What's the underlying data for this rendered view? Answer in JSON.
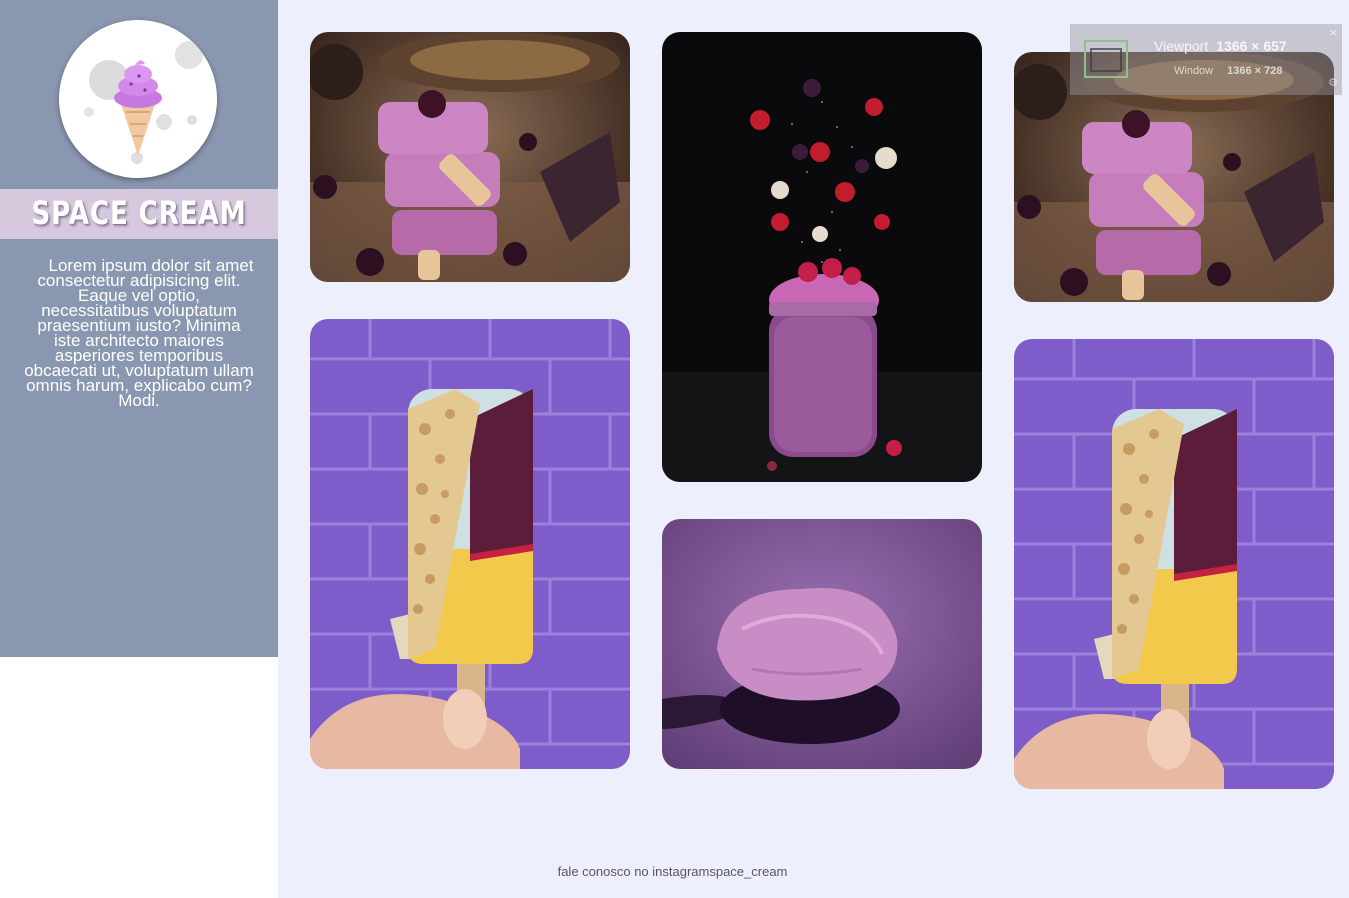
{
  "sidebar": {
    "brand_title": "SPACE CREAM",
    "description": "Lorem ipsum dolor sit amet consectetur adipisicing elit. Eaque vel optio, necessitatibus voluptatum praesentium iusto? Minima iste architecto maiores asperiores temporibus obcaecati ut, voluptatum ullam omnis harum, explicabo cum? Modi.",
    "logo_icon": "ice-cream-cone-icon"
  },
  "gallery": {
    "images": [
      {
        "subject": "stacked purple berry popsicles"
      },
      {
        "subject": "berry smoothie jar with flying fruit"
      },
      {
        "subject": "stacked purple berry popsicles"
      },
      {
        "subject": "nut-coated popsicle on purple brick wall"
      },
      {
        "subject": "spoon of pink ice cream"
      },
      {
        "subject": "nut-coated popsicle on purple brick wall"
      }
    ]
  },
  "footer": {
    "text": "fale conosco no instagramspace_cream"
  },
  "viewport_overlay": {
    "viewport_label": "Viewport",
    "viewport_size": "1366 × 657",
    "window_label": "Window",
    "window_size": "1366 × 728",
    "close_glyph": "×",
    "settings_glyph": "⚙"
  },
  "colors": {
    "sidebar_bg": "#8a97b0",
    "brand_bar": "#d6c8dd",
    "gallery_bg": "#eeeffc",
    "accent_purple": "#7e5cc9"
  }
}
